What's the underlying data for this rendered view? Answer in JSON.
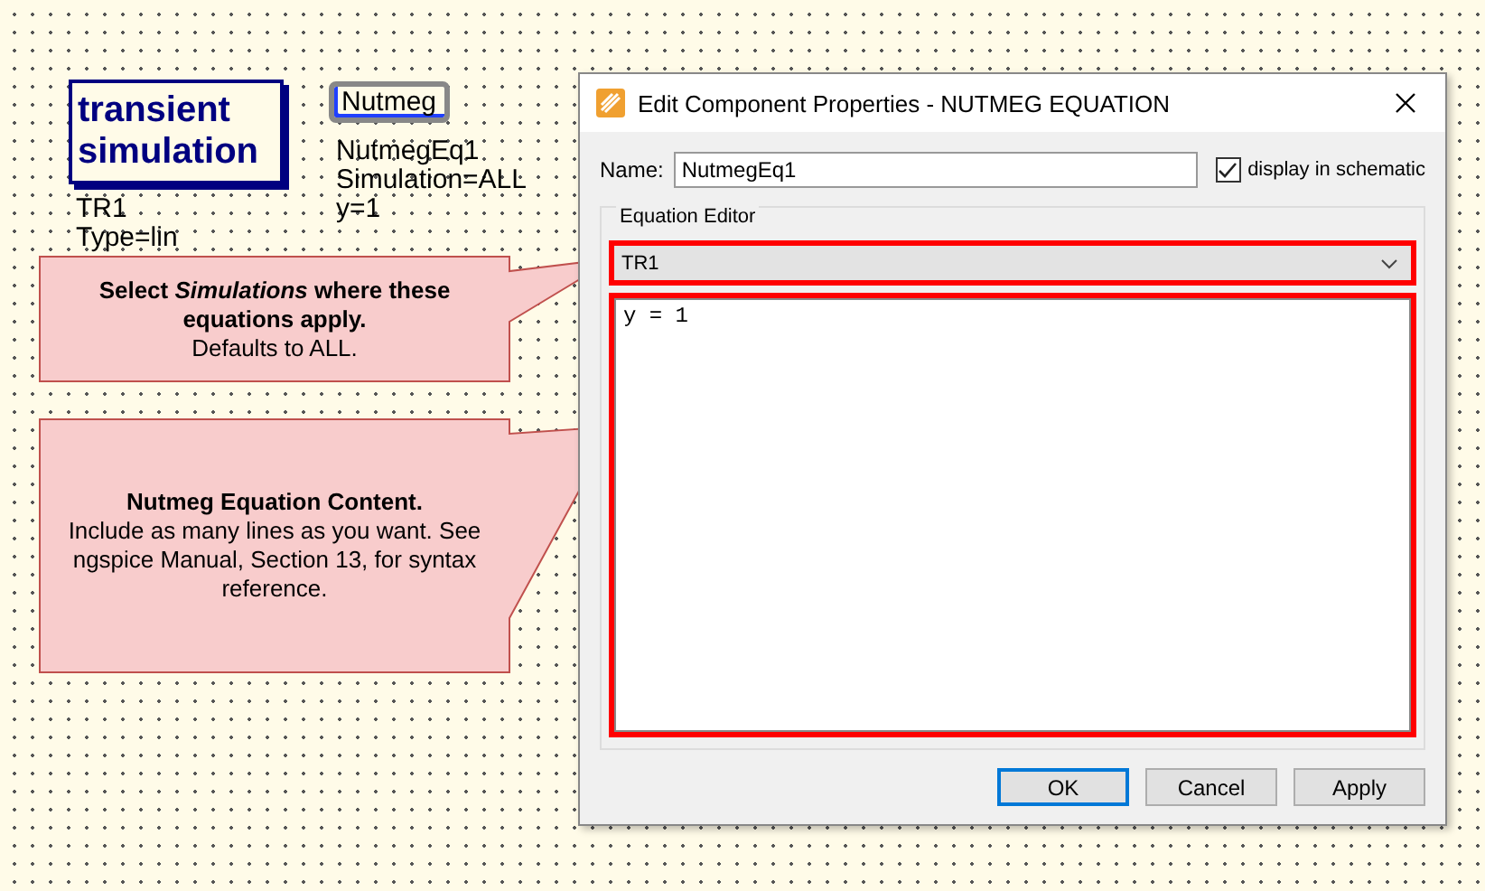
{
  "schematic": {
    "sim_block": {
      "title": "transient simulation",
      "lines": [
        "TR1",
        "Type=lin"
      ]
    },
    "eq_block": {
      "title": "Nutmeg",
      "lines": [
        "NutmegEq1",
        "Simulation=ALL",
        "y=1"
      ]
    },
    "callouts": [
      {
        "heading": "Select *Simulations* where these equations apply.",
        "body": "Defaults to ALL."
      },
      {
        "heading": "Nutmeg Equation Content.",
        "body": "Include as many lines as you want. See ngspice Manual, Section 13, for syntax reference."
      }
    ]
  },
  "dialog": {
    "title": "Edit Component Properties - NUTMEG EQUATION",
    "name_label": "Name:",
    "name_value": "NutmegEq1",
    "display_checkbox": {
      "label": "display in schematic",
      "checked": true
    },
    "group_label": "Equation Editor",
    "simulation": "TR1",
    "equations": "y = 1",
    "buttons": [
      {
        "label": "OK",
        "default": true
      },
      {
        "label": "Cancel",
        "default": false
      },
      {
        "label": "Apply",
        "default": false
      }
    ]
  }
}
